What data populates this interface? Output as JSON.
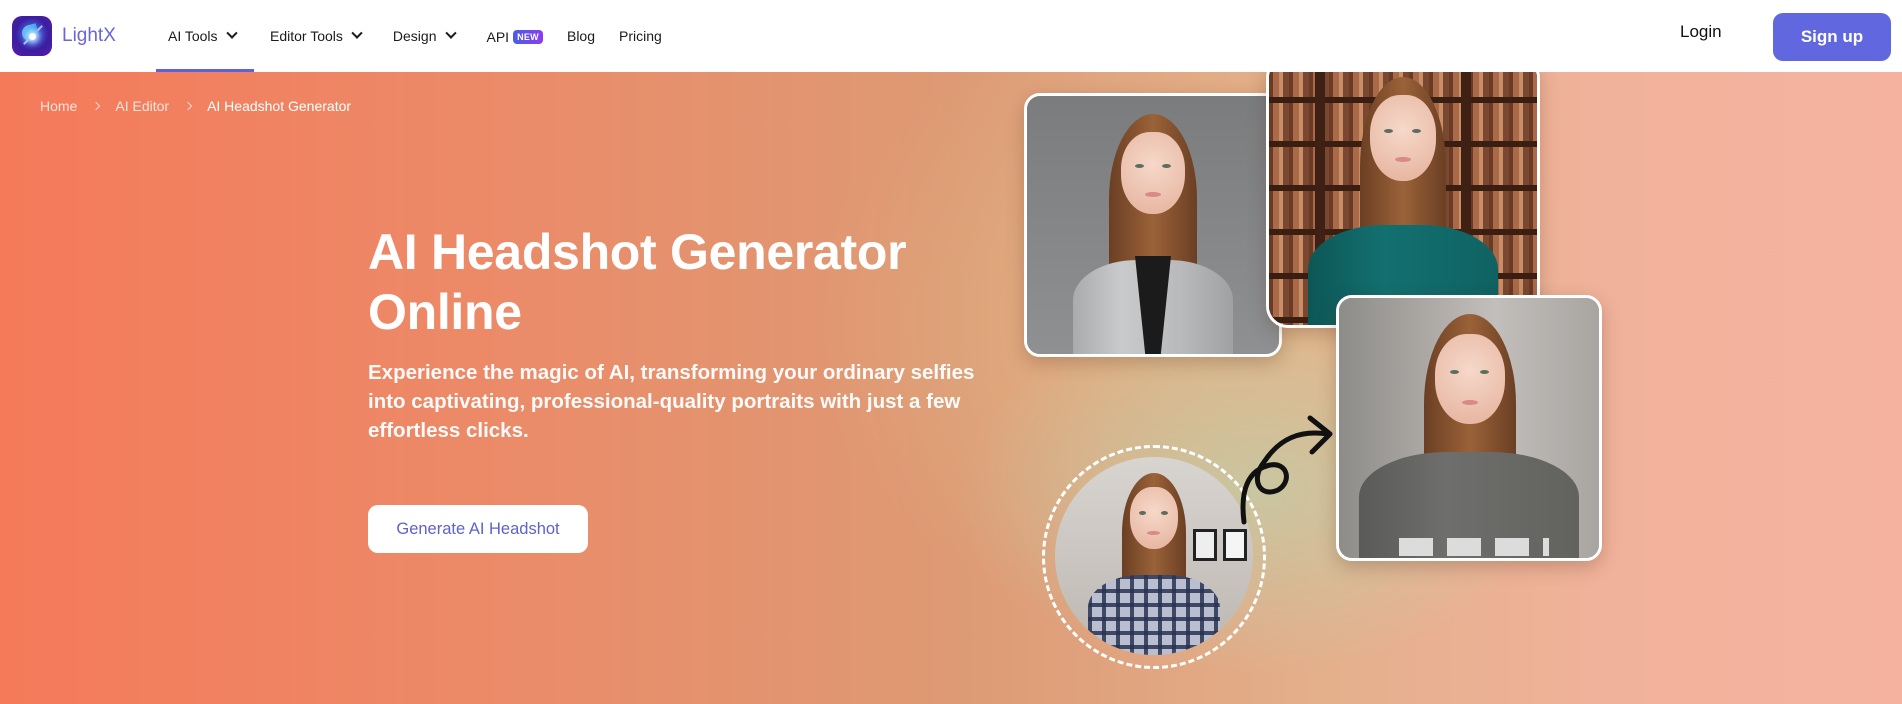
{
  "brand": {
    "name": "LightX",
    "logo_icon": "lightx-logo-icon",
    "accent": "#6167df"
  },
  "nav": {
    "items": [
      {
        "label": "AI Tools",
        "dropdown": true,
        "active": true
      },
      {
        "label": "Editor Tools",
        "dropdown": true,
        "active": false
      },
      {
        "label": "Design",
        "dropdown": true,
        "active": false
      },
      {
        "label": "API",
        "badge": "NEW",
        "dropdown": false,
        "active": false
      },
      {
        "label": "Blog",
        "dropdown": false,
        "active": false
      },
      {
        "label": "Pricing",
        "dropdown": false,
        "active": false
      }
    ],
    "login_label": "Login",
    "signup_label": "Sign up"
  },
  "breadcrumb": [
    {
      "label": "Home"
    },
    {
      "label": "AI Editor"
    },
    {
      "label": "AI Headshot Generator",
      "current": true
    }
  ],
  "hero": {
    "title_line1": "AI Headshot Generator",
    "title_line2": "Online",
    "subtitle": "Experience the magic of AI, transforming your ordinary selfies into captivating, professional-quality portraits with just a few effortless clicks.",
    "cta_label": "Generate AI Headshot"
  },
  "collage": {
    "images": [
      {
        "alt": "Headshot in grey blazer on grey backdrop"
      },
      {
        "alt": "Headshot in teal blouse in front of bookshelf"
      },
      {
        "alt": "Headshot in grey t-shirt on light backdrop"
      },
      {
        "alt": "Original selfie in plaid shirt"
      }
    ],
    "arrow_icon": "curved-arrow-icon"
  }
}
